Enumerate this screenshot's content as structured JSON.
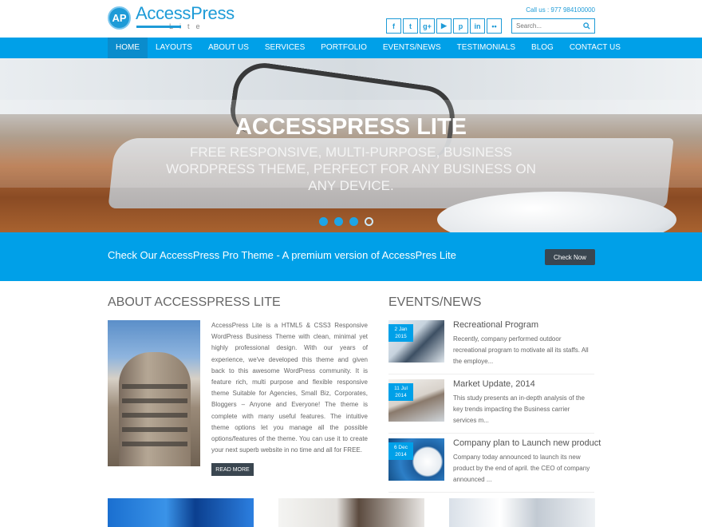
{
  "brand": {
    "logo_initials": "AP",
    "name": "AccessPress",
    "tagline": "Lite",
    "accent": "#00a0e8"
  },
  "header": {
    "call": "Call us : 977 984100000",
    "socials": [
      {
        "icon": "facebook-icon",
        "glyph": "f"
      },
      {
        "icon": "twitter-icon",
        "glyph": "t"
      },
      {
        "icon": "google-plus-icon",
        "glyph": "g+"
      },
      {
        "icon": "youtube-icon",
        "glyph": "▶"
      },
      {
        "icon": "pinterest-icon",
        "glyph": "p"
      },
      {
        "icon": "linkedin-icon",
        "glyph": "in"
      },
      {
        "icon": "flickr-icon",
        "glyph": "••"
      }
    ],
    "search_placeholder": "Search..."
  },
  "nav": {
    "items": [
      "HOME",
      "LAYOUTS",
      "ABOUT US",
      "SERVICES",
      "PORTFOLIO",
      "EVENTS/NEWS",
      "TESTIMONIALS",
      "BLOG",
      "CONTACT US"
    ],
    "active": "HOME"
  },
  "hero": {
    "title": "ACCESSPRESS LITE",
    "subtitle": "FREE RESPONSIVE, MULTI-PURPOSE, BUSINESS WORDPRESS THEME, PERFECT FOR ANY BUSINESS ON ANY DEVICE.",
    "slides_total": 4,
    "slide_active": 4
  },
  "promo": {
    "text": "Check Our AccessPress Pro Theme - A premium version of AccessPres Lite",
    "button": "Check Now"
  },
  "about": {
    "title": "ABOUT ACCESSPRESS LITE",
    "text": "AccessPress Lite is a HTML5 & CSS3 Responsive WordPress Business Theme with clean, minimal yet highly professional design. With our years of experience, we've developed this theme and given back to this awesome WordPress community. It is feature rich, multi purpose and flexible responsive theme Suitable for Agencies, Small Biz, Corporates, Bloggers – Anyone and Everyone! The theme is complete with many useful features. The intuitive theme options let you manage all the possible options/features of the theme. You can use it to create your next superb website in no time and all for FREE.",
    "read_more": "READ MORE"
  },
  "events": {
    "title": "EVENTS/NEWS",
    "items": [
      {
        "date_day": "2 Jan",
        "date_year": "2015",
        "title": "Recreational Program",
        "desc": "Recently, company performed outdoor recreational program to motivate all its staffs. All the employe..."
      },
      {
        "date_day": "11 Jul",
        "date_year": "2014",
        "title": "Market Update, 2014",
        "desc": "This study presents an in-depth analysis of the key trends impacting the Business carrier services m..."
      },
      {
        "date_day": "6 Dec",
        "date_year": "2014",
        "title": "Company plan to Launch new product",
        "desc": "Company today announced to launch its new product by the end of april. the CEO of company announced ..."
      }
    ]
  }
}
